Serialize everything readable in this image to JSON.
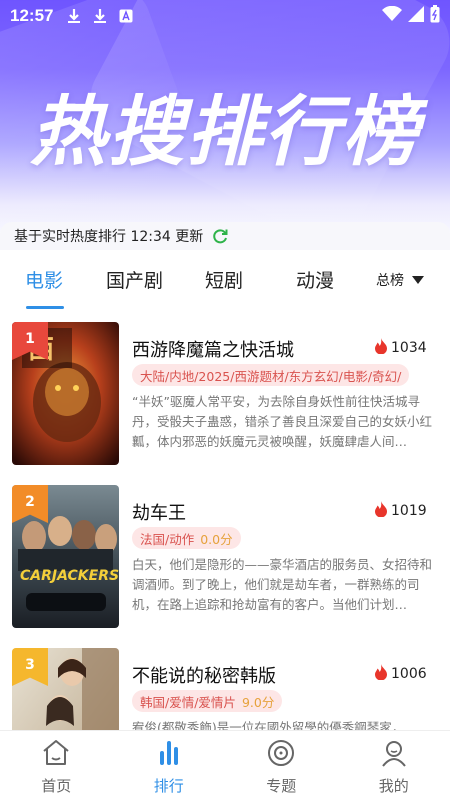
{
  "status": {
    "time": "12:57",
    "icons": [
      "download-icon",
      "download-icon",
      "a-icon",
      "wifi-icon",
      "signal-icon",
      "battery-icon"
    ]
  },
  "hero": {
    "title": "热搜排行榜"
  },
  "update": {
    "text": "基于实时热度排行 12:34 更新",
    "icon": "refresh-icon"
  },
  "tabs": [
    {
      "label": "电影",
      "active": true
    },
    {
      "label": "国产剧"
    },
    {
      "label": "短剧"
    },
    {
      "label": "动漫"
    }
  ],
  "sort": {
    "label": "总榜",
    "icon": "caret-down-icon"
  },
  "items": [
    {
      "rank": "1",
      "title": "西游降魔篇之快活城",
      "heat": "1034",
      "tags": "大陆/内地/2025/西游题材/东方玄幻/电影/奇幻/",
      "score": "",
      "desc": "“半妖”驱魔人常平安，为去除自身妖性前往快活城寻丹，受骰夫子蛊惑，错杀了善良且深爱自己的女妖小红瓤，体内邪恶的妖魔元灵被唤醒，妖魔肆虐人间…"
    },
    {
      "rank": "2",
      "title": "劫车王",
      "heat": "1019",
      "tags": "法国/动作",
      "score": "0.0分",
      "desc": "白天，他们是隐形的——豪华酒店的服务员、女招待和调酒师。到了晚上，他们就是劫车者，一群熟练的司机，在路上追踪和抢劫富有的客户。当他们计划…"
    },
    {
      "rank": "3",
      "title": "不能说的秘密韩版",
      "heat": "1006",
      "tags": "韩国/爱情/爱情片",
      "score": "9.0分",
      "desc": "宥俊(都敬秀飾)是一位在國外留學的優秀鋼琴家，"
    }
  ],
  "colors": {
    "accent": "#2f8fe6",
    "rank1": "#e8483c",
    "rank2": "#f28c28",
    "rank3": "#f5b72d",
    "heat": "#e8352b"
  },
  "nav": [
    {
      "label": "首页",
      "icon": "home-icon"
    },
    {
      "label": "排行",
      "icon": "ranking-icon",
      "active": true
    },
    {
      "label": "专题",
      "icon": "disc-icon"
    },
    {
      "label": "我的",
      "icon": "user-icon"
    }
  ]
}
